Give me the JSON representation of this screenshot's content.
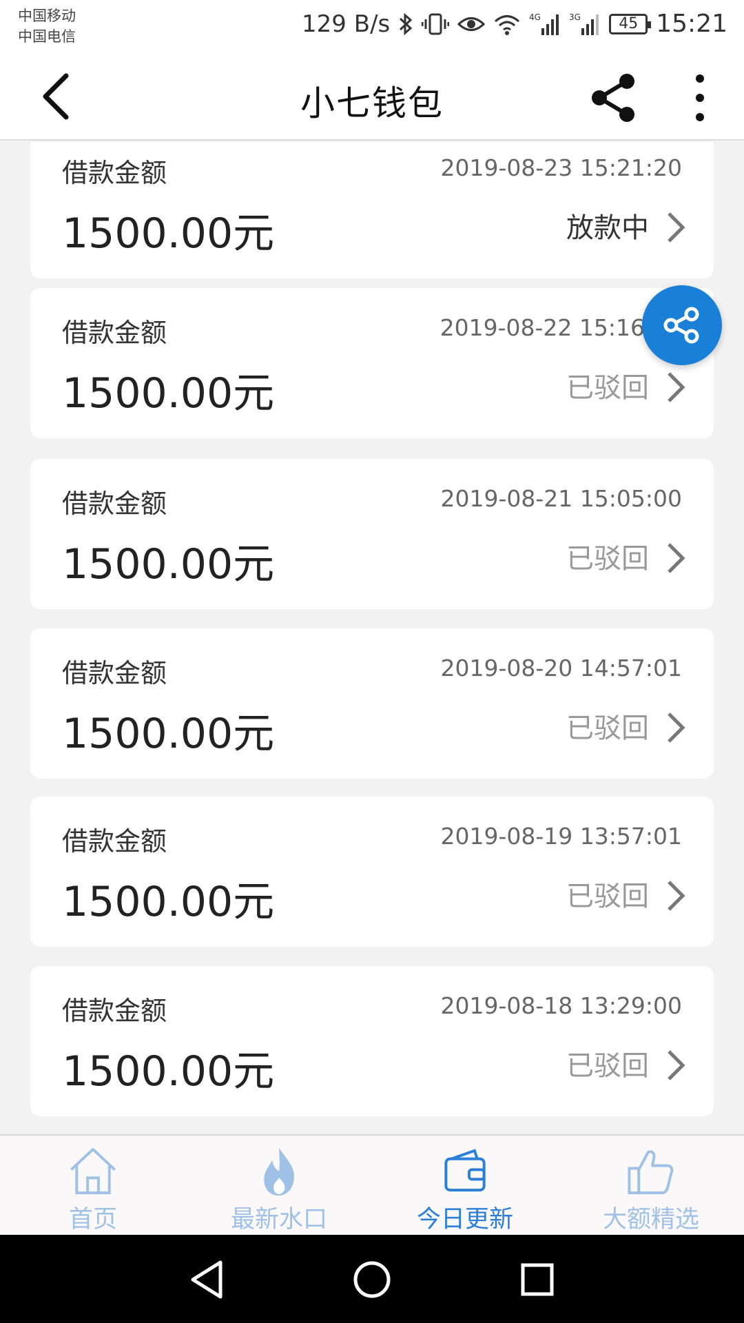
{
  "status_bar": {
    "carrier1": "中国移动",
    "carrier2": "中国电信",
    "speed": "129 B/s",
    "battery": "45",
    "time": "15:21"
  },
  "header": {
    "title": "小七钱包"
  },
  "loans": [
    {
      "label": "借款金额",
      "datetime": "2019-08-23 15:21:20",
      "amount": "1500.00元",
      "status": "放款中"
    },
    {
      "label": "借款金额",
      "datetime": "2019-08-22 15:16",
      "amount": "1500.00元",
      "status": "已驳回"
    },
    {
      "label": "借款金额",
      "datetime": "2019-08-21 15:05:00",
      "amount": "1500.00元",
      "status": "已驳回"
    },
    {
      "label": "借款金额",
      "datetime": "2019-08-20 14:57:01",
      "amount": "1500.00元",
      "status": "已驳回"
    },
    {
      "label": "借款金额",
      "datetime": "2019-08-19 13:57:01",
      "amount": "1500.00元",
      "status": "已驳回"
    },
    {
      "label": "借款金额",
      "datetime": "2019-08-18 13:29:00",
      "amount": "1500.00元",
      "status": "已驳回"
    }
  ],
  "bottom_nav": [
    {
      "label": "首页",
      "icon": "home-icon"
    },
    {
      "label": "最新水口",
      "icon": "flame-icon"
    },
    {
      "label": "今日更新",
      "icon": "wallet-icon",
      "active": true
    },
    {
      "label": "大额精选",
      "icon": "thumbs-up-icon"
    }
  ],
  "colors": {
    "accent": "#2b7fd8",
    "fab": "#1a7fd6",
    "nav_inactive": "#9fc1e6"
  }
}
